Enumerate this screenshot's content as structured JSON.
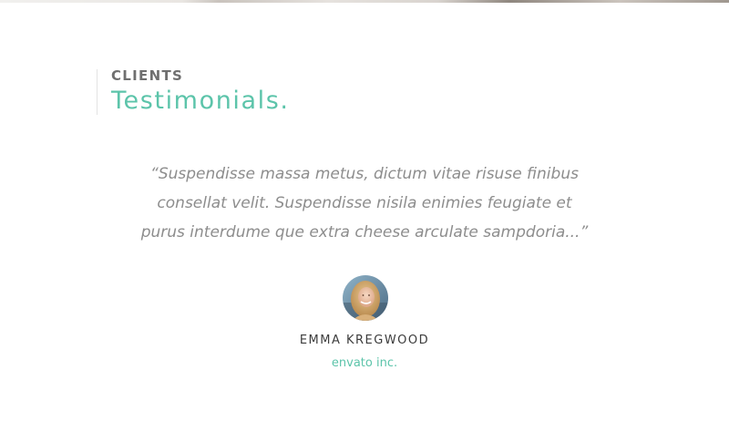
{
  "section": {
    "eyebrow": "CLIENTS",
    "title": "Testimonials."
  },
  "testimonial": {
    "quote": "“Suspendisse massa metus, dictum vitae risuse finibus consellat velit. Suspendisse nisila enimies feugiate et purus interdume que extra cheese arculate sampdoria...”",
    "author_name": "EMMA KREGWOOD",
    "author_company": "envato inc."
  },
  "colors": {
    "accent": "#5cc4aa",
    "quote_text": "#8d8d8d",
    "eyebrow_text": "#6f6f6f",
    "name_text": "#3c3c3c"
  }
}
